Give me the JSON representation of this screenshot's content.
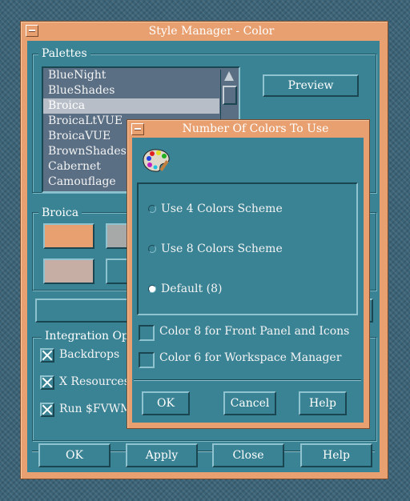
{
  "main_window": {
    "title": "Style Manager - Color",
    "palettes_label": "Palettes",
    "palettes": [
      "BlueNight",
      "BlueShades",
      "Broica",
      "BroicaLtVUE",
      "BroicaVUE",
      "BrownShades",
      "Cabernet",
      "Camouflage"
    ],
    "selected_palette": "Broica",
    "preview_label": "Preview",
    "palette_group_label": "Broica",
    "swatch_colors": [
      "#e8a070",
      "#a7a8a8",
      "#c7aea4",
      "#3a8394"
    ],
    "integration_label": "Integration Op",
    "options": [
      {
        "label": "Backdrops",
        "checked": true
      },
      {
        "label": "X Resources",
        "checked": true
      },
      {
        "label": "Run $FVWM_",
        "checked": true
      }
    ],
    "buttons": {
      "ok": "OK",
      "apply": "Apply",
      "close": "Close",
      "help": "Help"
    }
  },
  "dialog": {
    "title": "Number Of Colors To Use",
    "radio_options": [
      {
        "label": "Use 4 Colors Scheme",
        "selected": false
      },
      {
        "label": "Use 8 Colors Scheme",
        "selected": false
      },
      {
        "label": "Default (8)",
        "selected": true
      }
    ],
    "checkboxes": [
      {
        "label": "Color 8 for Front Panel and Icons",
        "checked": false
      },
      {
        "label": "Color 6 for Workspace Manager",
        "checked": false
      }
    ],
    "buttons": {
      "ok": "OK",
      "cancel": "Cancel",
      "help": "Help"
    }
  },
  "colors": {
    "border": "#e8a070",
    "client": "#3a8394",
    "list_bg": "#5a6e84",
    "selection": "#b8bec8"
  }
}
